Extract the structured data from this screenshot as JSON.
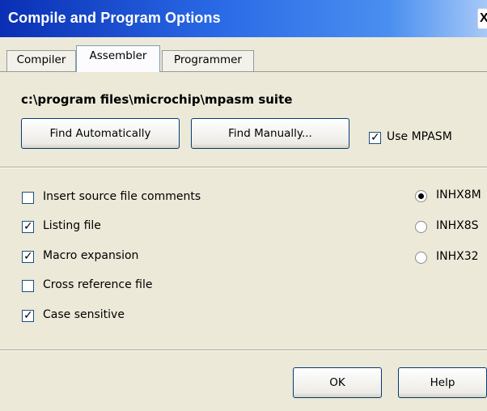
{
  "window": {
    "title": "Compile and Program Options",
    "close_glyph": "X"
  },
  "tabs": [
    {
      "label": "Compiler",
      "active": false
    },
    {
      "label": "Assembler",
      "active": true
    },
    {
      "label": "Programmer",
      "active": false
    }
  ],
  "assembler": {
    "path": "c:\\program files\\microchip\\mpasm suite",
    "find_auto_label": "Find Automatically",
    "find_manual_label": "Find Manually...",
    "use_mpasm": {
      "label": "Use MPASM",
      "checked": true
    }
  },
  "options": [
    {
      "label": "Insert source file comments",
      "checked": false
    },
    {
      "label": "Listing file",
      "checked": true
    },
    {
      "label": "Macro expansion",
      "checked": true
    },
    {
      "label": "Cross reference file",
      "checked": false
    },
    {
      "label": "Case sensitive",
      "checked": true
    }
  ],
  "hex_formats": [
    {
      "label": "INHX8M",
      "selected": true
    },
    {
      "label": "INHX8S",
      "selected": false
    },
    {
      "label": "INHX32",
      "selected": false
    }
  ],
  "footer": {
    "ok_label": "OK",
    "help_label": "Help"
  },
  "glyphs": {
    "check": "✓"
  }
}
